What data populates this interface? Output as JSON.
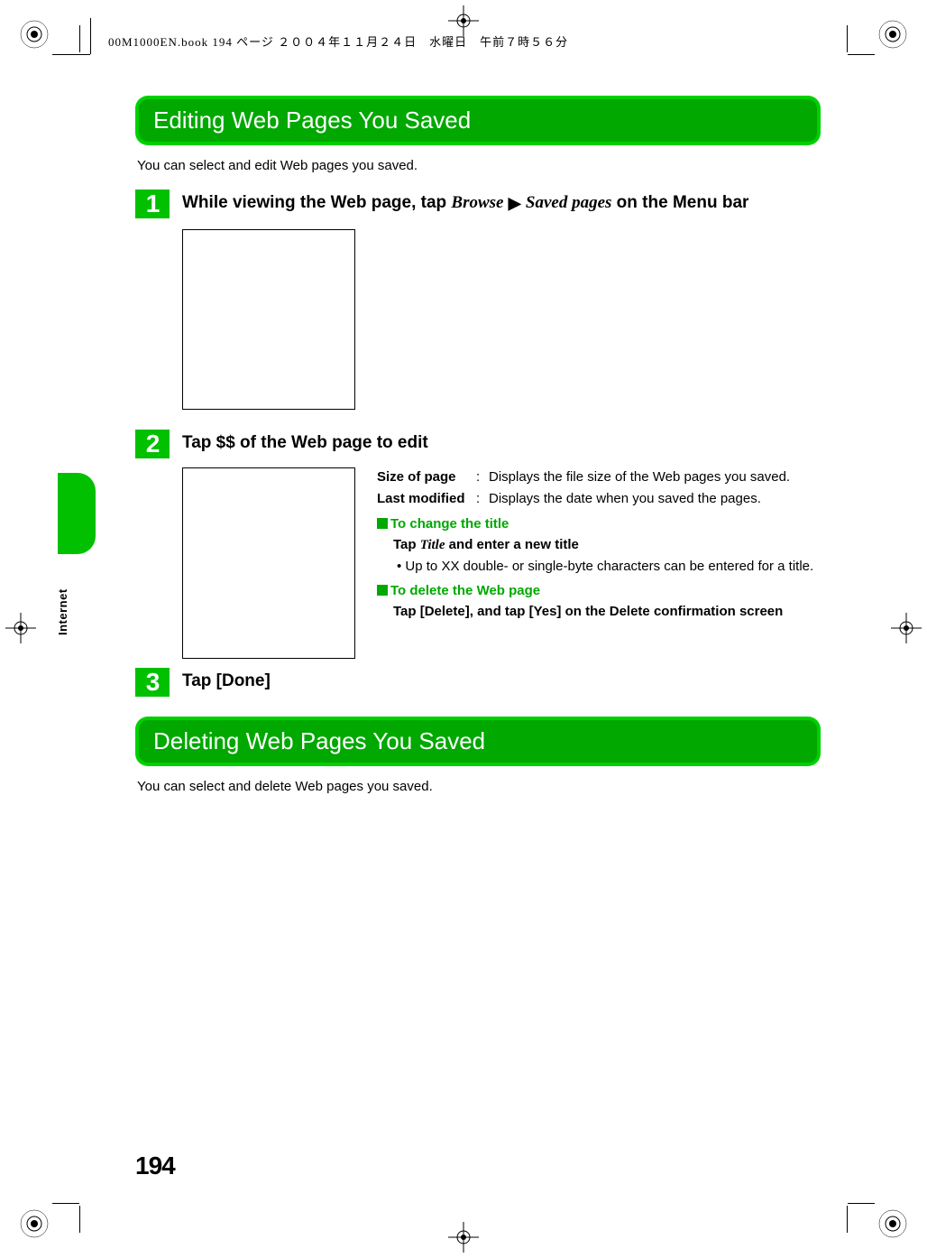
{
  "running_header": "00M1000EN.book  194 ページ  ２００４年１１月２４日　水曜日　午前７時５６分",
  "section1": {
    "heading": "Editing Web Pages You Saved",
    "intro": "You can select and edit Web pages you saved.",
    "step1": {
      "num": "1",
      "pre": "While viewing the Web page, tap ",
      "italic1": "Browse",
      "mid": " ",
      "arrow": "▶",
      "italic2": "Saved pages",
      "post": " on the Menu bar"
    },
    "step2": {
      "num": "2",
      "title": "Tap $$ of the Web page to edit",
      "defs": {
        "size_label": "Size of page",
        "size_val": "Displays the file size of the Web pages you saved.",
        "last_label": "Last modified",
        "last_val": "Displays the date when you saved the pages."
      },
      "change_title_heading": "To change the title",
      "change_title_inst_pre": "Tap ",
      "change_title_inst_italic": "Title",
      "change_title_inst_post": " and enter a new title",
      "change_title_bullet": "Up to XX double- or single-byte characters can be entered for a title.",
      "delete_heading": "To delete the Web page",
      "delete_inst": "Tap [Delete], and tap [Yes] on the Delete confirmation screen"
    },
    "step3": {
      "num": "3",
      "title": "Tap [Done]"
    }
  },
  "section2": {
    "heading": "Deleting Web Pages You Saved",
    "intro": "You can select and delete Web pages you saved."
  },
  "side_tab_label": "Internet",
  "page_number": "194"
}
